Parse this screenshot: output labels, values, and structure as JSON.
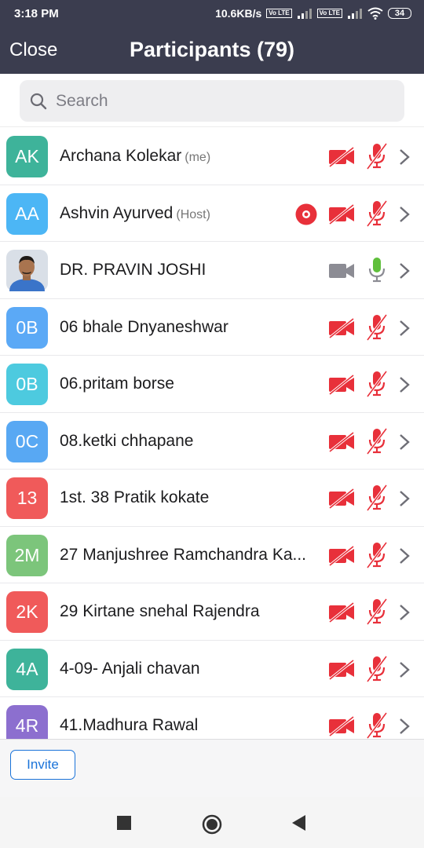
{
  "status_bar": {
    "time": "3:18 PM",
    "network_speed": "10.6KB/s",
    "volte": "Vo LTE",
    "battery": "34"
  },
  "header": {
    "close_label": "Close",
    "title": "Participants (79)"
  },
  "search": {
    "placeholder": "Search"
  },
  "participants": [
    {
      "initials": "AK",
      "name": "Archana Kolekar",
      "tag": "(me)",
      "avatar_color": "#3eb39a",
      "video": "off",
      "audio": "muted"
    },
    {
      "initials": "AA",
      "name": "Ashvin Ayurved",
      "tag": "(Host)",
      "avatar_color": "#4cb6f5",
      "video": "off",
      "audio": "muted",
      "recording": true
    },
    {
      "initials": "",
      "name": "DR. PRAVIN JOSHI",
      "tag": "",
      "avatar_color": "#c8d2de",
      "photo": true,
      "video": "available",
      "audio": "active"
    },
    {
      "initials": "0B",
      "name": "06 bhale Dnyaneshwar",
      "tag": "",
      "avatar_color": "#5ba9f6",
      "video": "off",
      "audio": "muted"
    },
    {
      "initials": "0B",
      "name": "06.pritam borse",
      "tag": "",
      "avatar_color": "#4dcadf",
      "video": "off",
      "audio": "muted"
    },
    {
      "initials": "0C",
      "name": "08.ketki chhapane",
      "tag": "",
      "avatar_color": "#58a8f3",
      "video": "off",
      "audio": "muted"
    },
    {
      "initials": "13",
      "name": "1st. 38 Pratik kokate",
      "tag": "",
      "avatar_color": "#f05a5a",
      "video": "off",
      "audio": "muted"
    },
    {
      "initials": "2M",
      "name": "27 Manjushree Ramchandra Ka...",
      "tag": "",
      "avatar_color": "#7cc57b",
      "video": "off",
      "audio": "muted"
    },
    {
      "initials": "2K",
      "name": "29 Kirtane snehal Rajendra",
      "tag": "",
      "avatar_color": "#f05a5a",
      "video": "off",
      "audio": "muted"
    },
    {
      "initials": "4A",
      "name": "4-09- Anjali chavan",
      "tag": "",
      "avatar_color": "#3eb39a",
      "video": "off",
      "audio": "muted"
    },
    {
      "initials": "4R",
      "name": "41.Madhura Rawal",
      "tag": "",
      "avatar_color": "#8c6fcf",
      "video": "off",
      "audio": "muted"
    }
  ],
  "footer": {
    "invite_label": "Invite"
  },
  "colors": {
    "header_bg": "#3b3d4f",
    "muted_red": "#e8303a",
    "active_green": "#5fbf3b",
    "accent_blue": "#1a73d9"
  },
  "nav_bar": {
    "icons": [
      "recents-square-icon",
      "home-circle-icon",
      "back-triangle-icon"
    ]
  }
}
